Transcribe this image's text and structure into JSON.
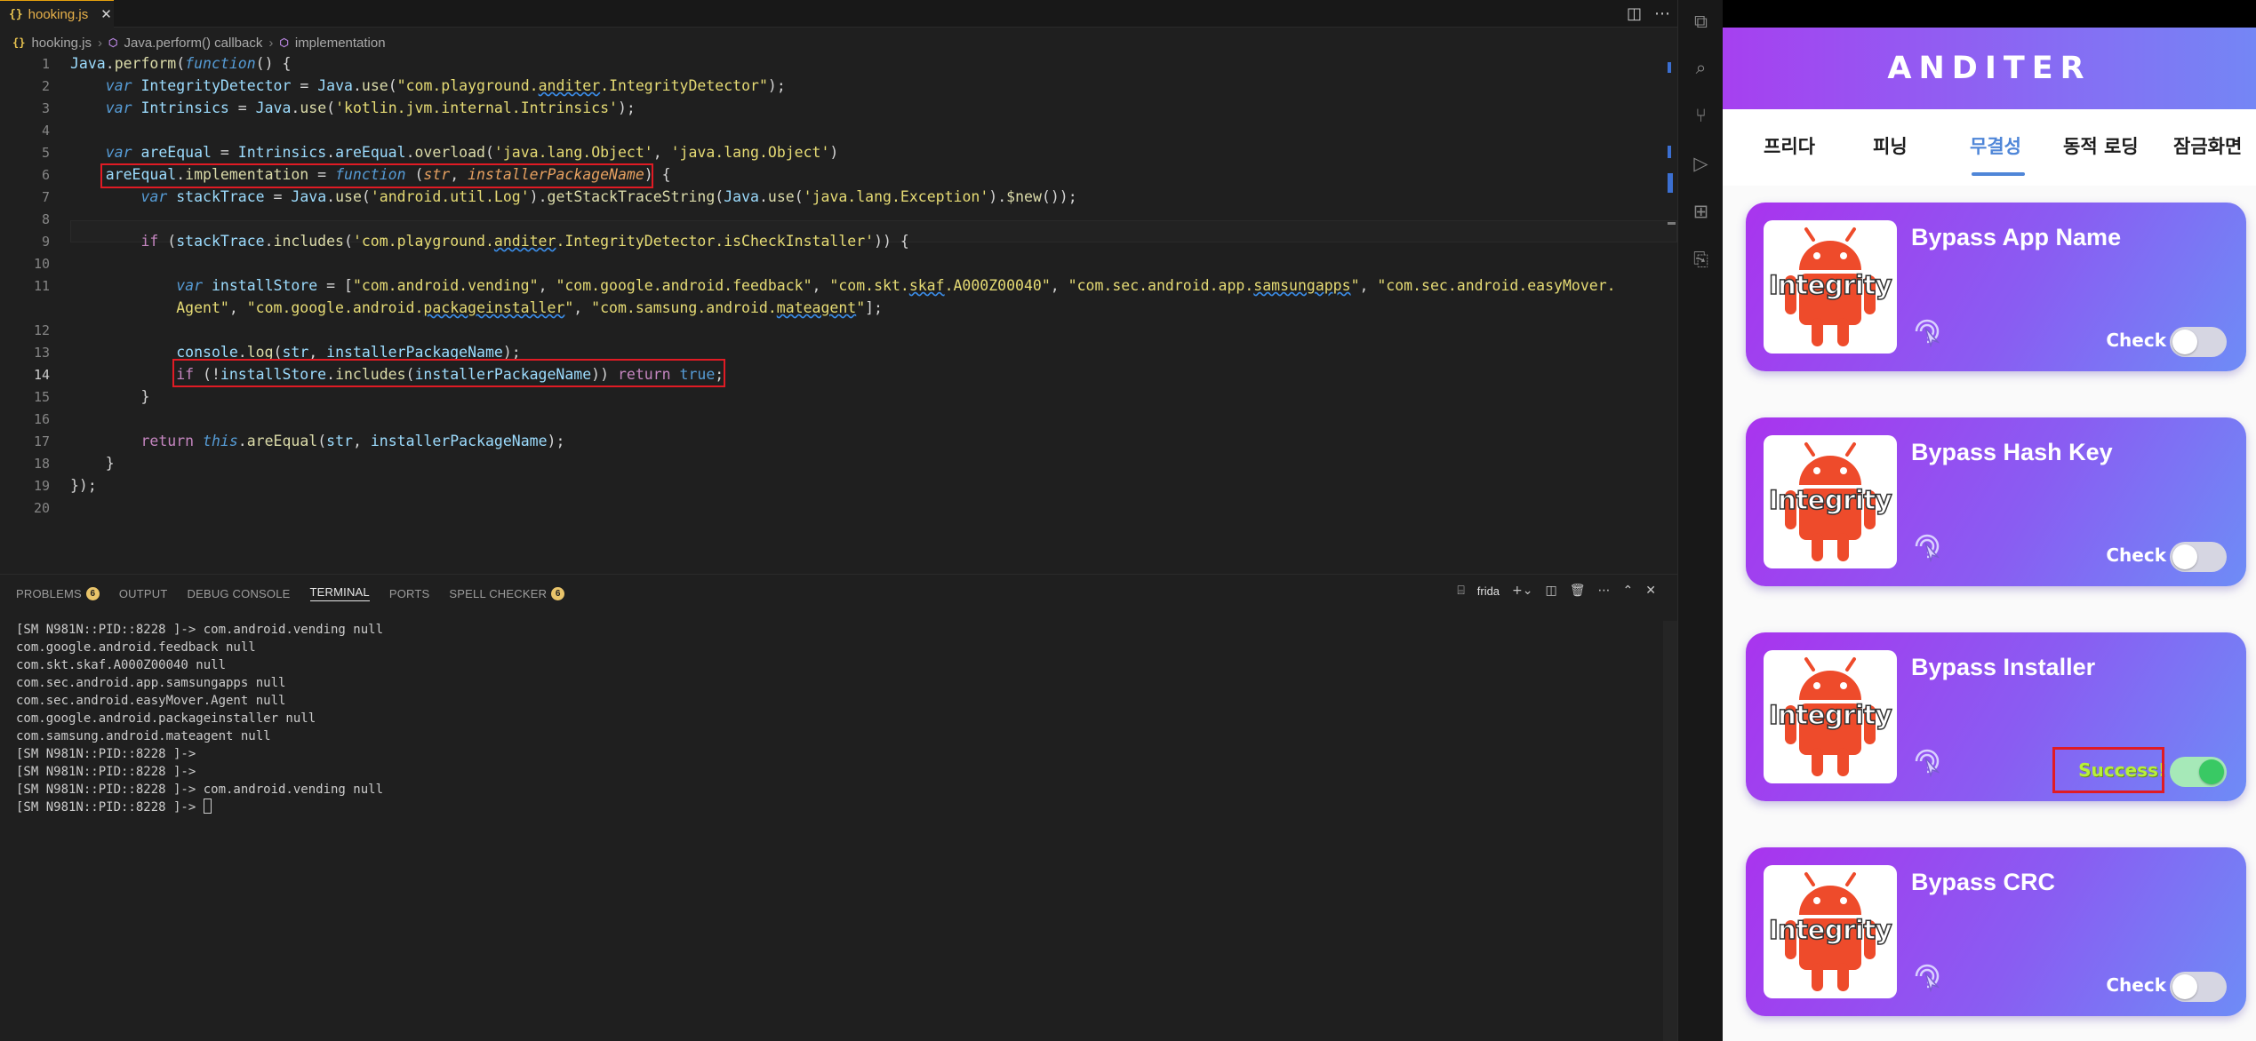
{
  "editor": {
    "tab": {
      "icon": "{}",
      "name": "hooking.js",
      "close": "✕"
    },
    "breadcrumb": [
      "hooking.js",
      "Java.perform() callback",
      "implementation"
    ],
    "current_line": "14"
  },
  "panel": {
    "tabs": [
      {
        "label": "PROBLEMS",
        "badge": "6"
      },
      {
        "label": "OUTPUT"
      },
      {
        "label": "DEBUG CONSOLE"
      },
      {
        "label": "TERMINAL"
      },
      {
        "label": "PORTS"
      },
      {
        "label": "SPELL CHECKER",
        "badge": "6"
      }
    ],
    "active_tab": "TERMINAL",
    "terminal_name": "frida",
    "terminal_lines": [
      "[SM N981N::PID::8228 ]-> com.android.vending null",
      "com.google.android.feedback null",
      "com.skt.skaf.A000Z00040 null",
      "com.sec.android.app.samsungapps null",
      "com.sec.android.easyMover.Agent null",
      "com.google.android.packageinstaller null",
      "com.samsung.android.mateagent null",
      "[SM N981N::PID::8228 ]->",
      "[SM N981N::PID::8228 ]->",
      "[SM N981N::PID::8228 ]-> com.android.vending null",
      "[SM N981N::PID::8228 ]-> "
    ]
  },
  "app": {
    "title": "ANDITER",
    "tabs": [
      "프리다",
      "피닝",
      "무결성",
      "동적 로딩",
      "잠금화면"
    ],
    "active_tab": "무결성",
    "thumb_label": "Integrity",
    "cards": [
      {
        "title": "Bypass App Name",
        "status": "Check",
        "toggle_on": false
      },
      {
        "title": "Bypass Hash Key",
        "status": "Check",
        "toggle_on": false
      },
      {
        "title": "Bypass Installer",
        "status": "Success!",
        "toggle_on": true
      },
      {
        "title": "Bypass CRC",
        "status": "Check",
        "toggle_on": false
      }
    ]
  },
  "colors": {
    "accent": "#4f86d8",
    "card_from": "#a934ee",
    "card_to": "#6e8cf6",
    "highlight": "#e01b24",
    "success": "#b7ef3a",
    "android": "#ee4b2b"
  }
}
